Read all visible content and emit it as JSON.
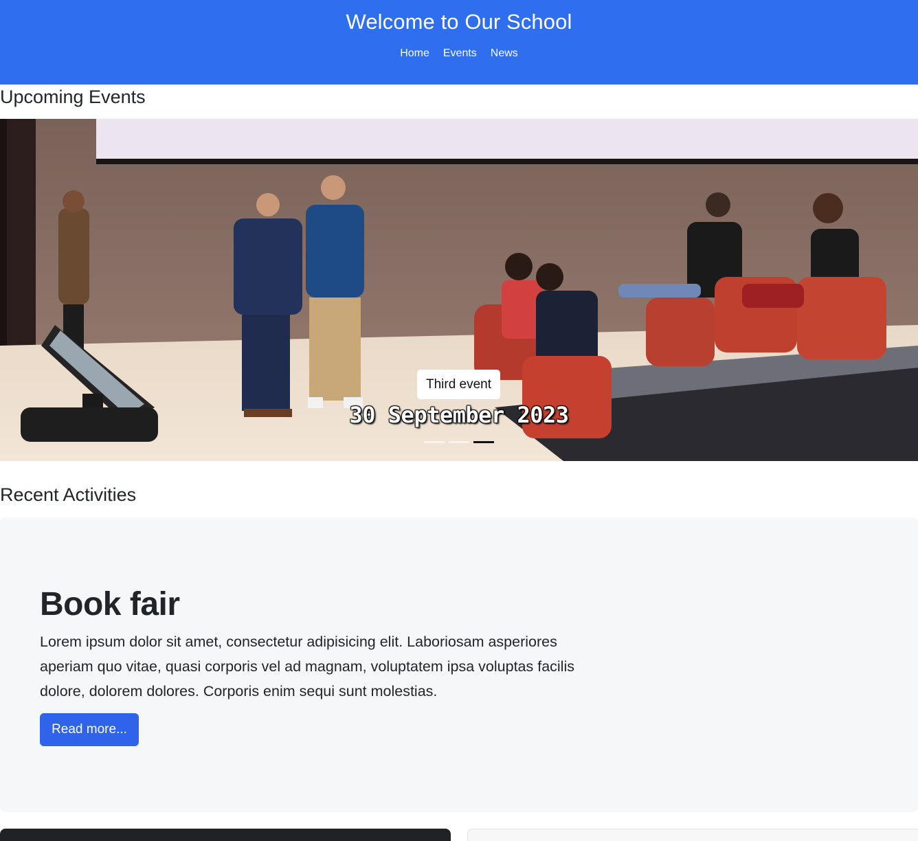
{
  "header": {
    "title": "Welcome to Our School",
    "nav": [
      {
        "label": "Home"
      },
      {
        "label": "Events"
      },
      {
        "label": "News"
      }
    ]
  },
  "events": {
    "heading": "Upcoming Events",
    "carousel": {
      "caption_title": "Third event",
      "caption_date": "30 September 2023",
      "slide_count": 3,
      "active_index": 2
    }
  },
  "activities": {
    "heading": "Recent Activities",
    "feature": {
      "title": "Book fair",
      "text": "Lorem ipsum dolor sit amet, consectetur adipisicing elit. Laboriosam asperiores aperiam quo vitae, quasi corporis vel ad magnam, voluptatem ipsa voluptas facilis dolore, dolorem dolores. Corporis enim sequi sunt molestias.",
      "button_label": "Read more..."
    }
  },
  "colors": {
    "header_bg": "#2f6fef",
    "button_bg": "#2f63ea",
    "feature_bg": "#f6f7f9"
  }
}
